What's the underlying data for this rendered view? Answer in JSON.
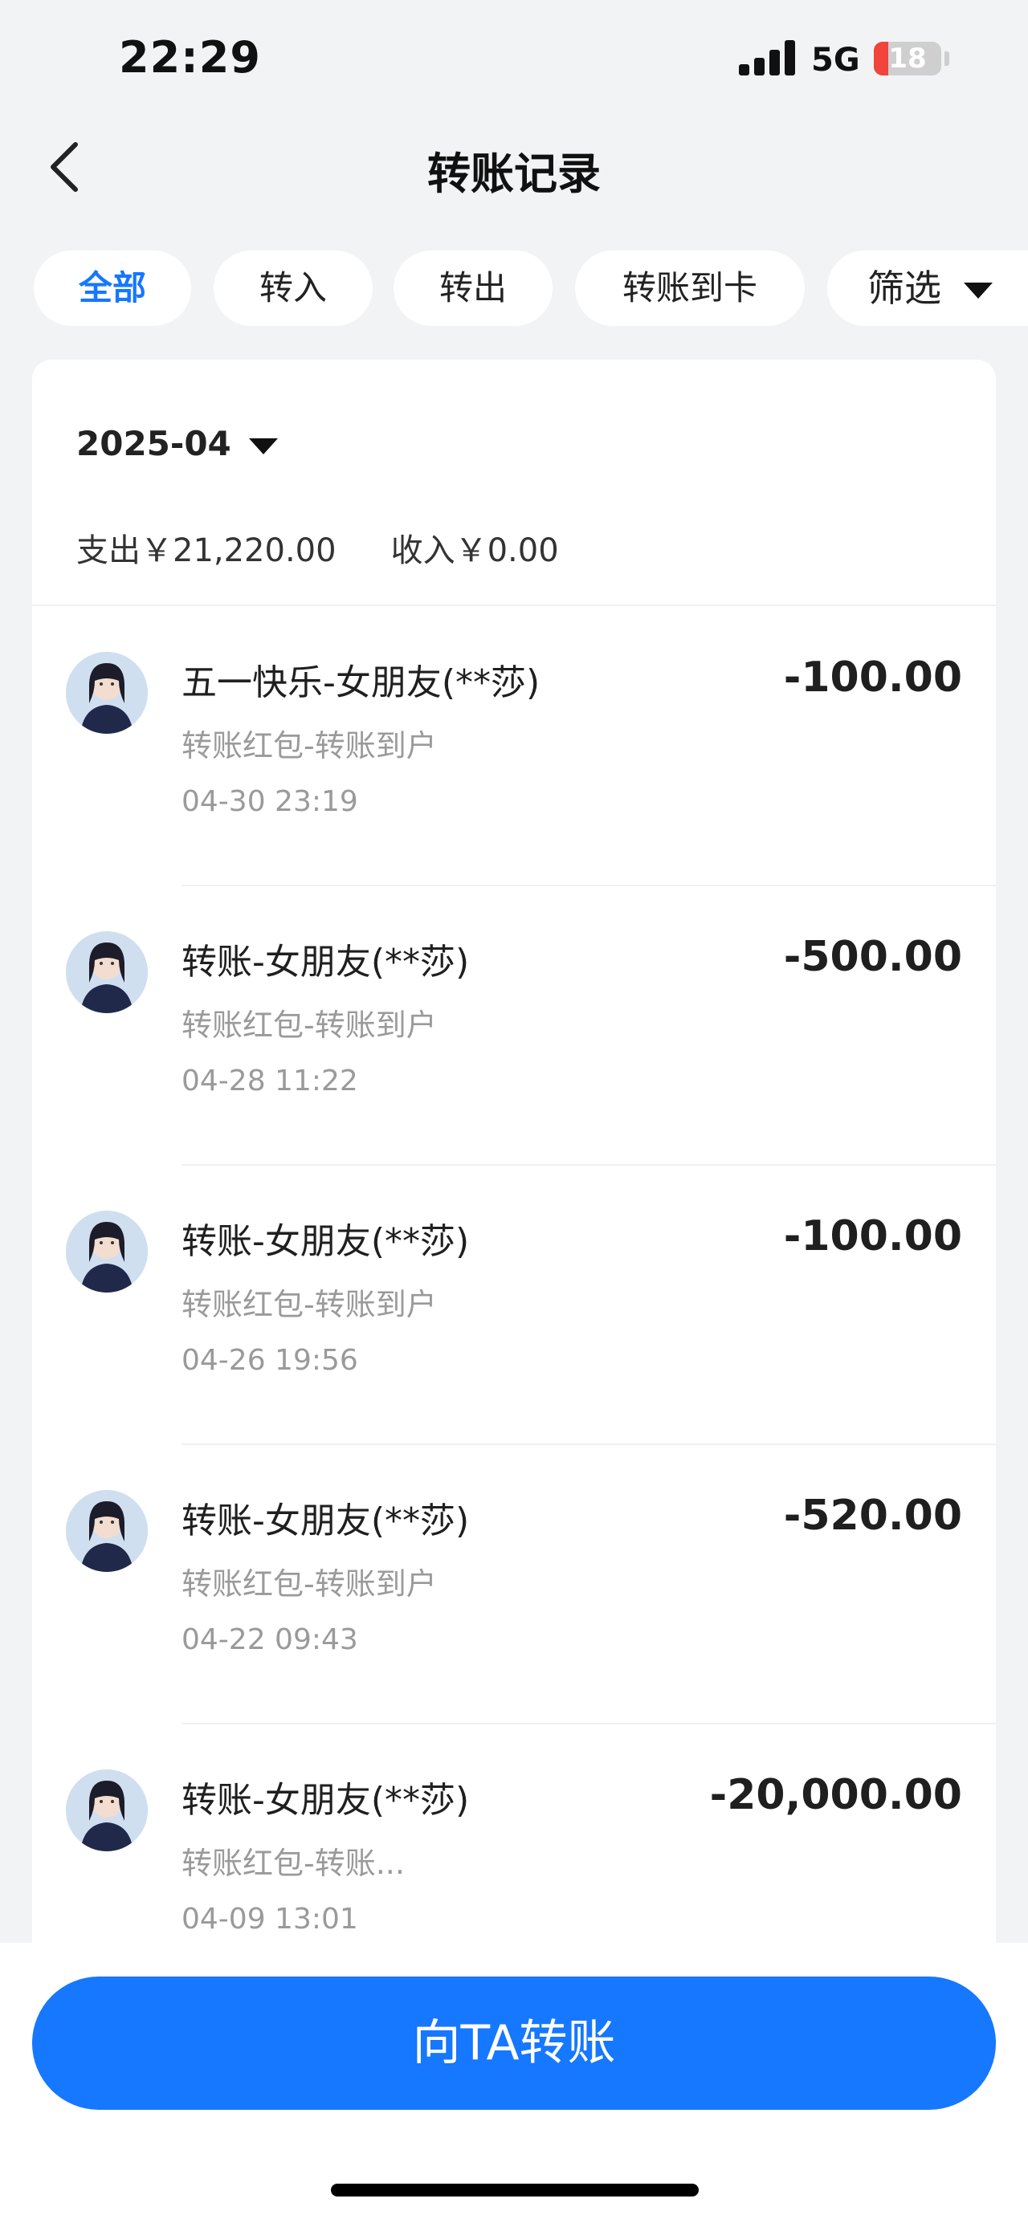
{
  "status_bar": {
    "time": "22:29",
    "network": "5G",
    "battery": "18"
  },
  "nav": {
    "title": "转账记录"
  },
  "tabs": [
    {
      "label": "全部",
      "active": true
    },
    {
      "label": "转入",
      "active": false
    },
    {
      "label": "转出",
      "active": false
    },
    {
      "label": "转账到卡",
      "active": false
    }
  ],
  "filter": {
    "label": "筛选"
  },
  "summary": {
    "month": "2025-04",
    "expense": "支出￥21,220.00",
    "income": "收入￥0.00"
  },
  "transactions": [
    {
      "title": "五一快乐-女朋友(**莎)",
      "subtitle": "转账红包-转账到户",
      "time": "04-30 23:19",
      "amount": "-100.00"
    },
    {
      "title": "转账-女朋友(**莎)",
      "subtitle": "转账红包-转账到户",
      "time": "04-28 11:22",
      "amount": "-500.00"
    },
    {
      "title": "转账-女朋友(**莎)",
      "subtitle": "转账红包-转账到户",
      "time": "04-26 19:56",
      "amount": "-100.00"
    },
    {
      "title": "转账-女朋友(**莎)",
      "subtitle": "转账红包-转账到户",
      "time": "04-22 09:43",
      "amount": "-520.00"
    },
    {
      "title": "转账-女朋友(**莎)",
      "subtitle": "转账红包-转账...",
      "time": "04-09 13:01",
      "amount": "-20,000.00"
    }
  ],
  "cta": {
    "label": "向TA转账"
  },
  "colors": {
    "accent": "#1677ff",
    "background": "#f2f3f5",
    "battery_low": "#f0443c"
  }
}
